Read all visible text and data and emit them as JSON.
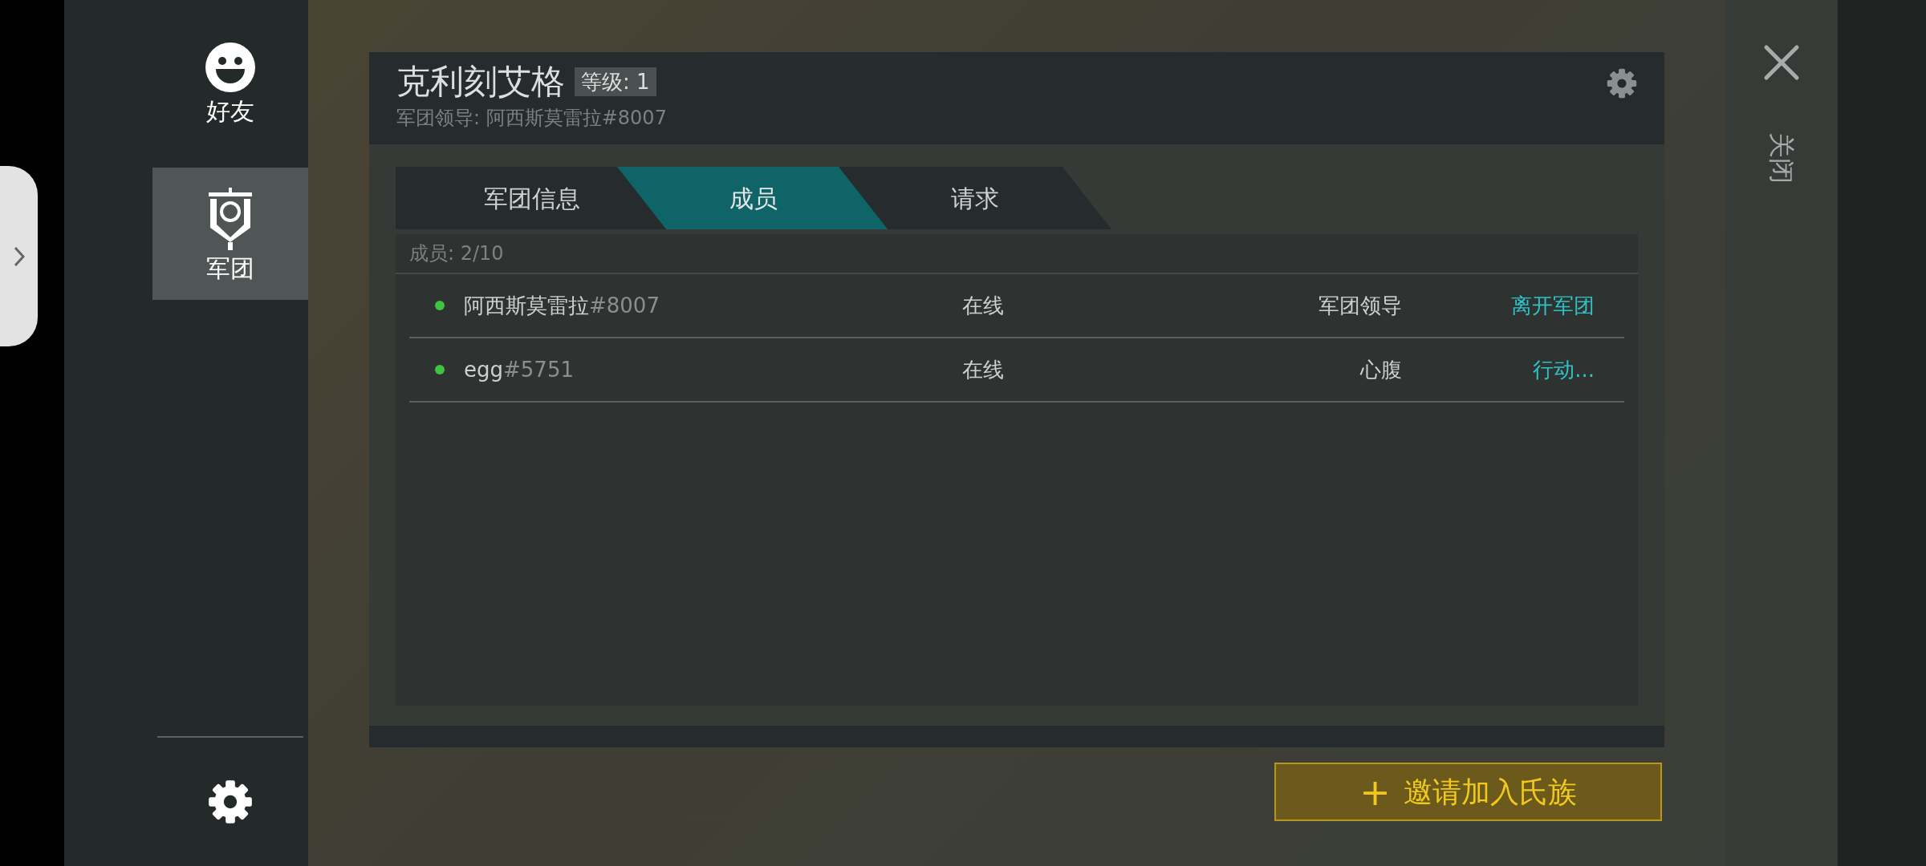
{
  "sidebar": {
    "items": [
      {
        "label": "好友",
        "kind": "friends",
        "selected": false
      },
      {
        "label": "军团",
        "kind": "clan",
        "selected": true
      }
    ]
  },
  "dialog": {
    "title": "克利刻艾格",
    "level_badge": "等级: 1",
    "subtitle": "军团领导: 阿西斯莫雷拉#8007",
    "tabs": [
      {
        "label": "军团信息",
        "selected": false
      },
      {
        "label": "成员",
        "selected": true
      },
      {
        "label": "请求",
        "selected": false
      }
    ],
    "members_count": "成员: 2/10",
    "members": [
      {
        "name": "阿西斯莫雷拉",
        "tag": "#8007",
        "online": true,
        "status": "在线",
        "role": "军团领导",
        "action": "离开军团"
      },
      {
        "name": "egg",
        "tag": "#5751",
        "online": true,
        "status": "在线",
        "role": "心腹",
        "action": "行动..."
      }
    ]
  },
  "invite_button": {
    "icon": "+",
    "label": "邀请加入氏族"
  },
  "close": {
    "label": "关闭"
  }
}
